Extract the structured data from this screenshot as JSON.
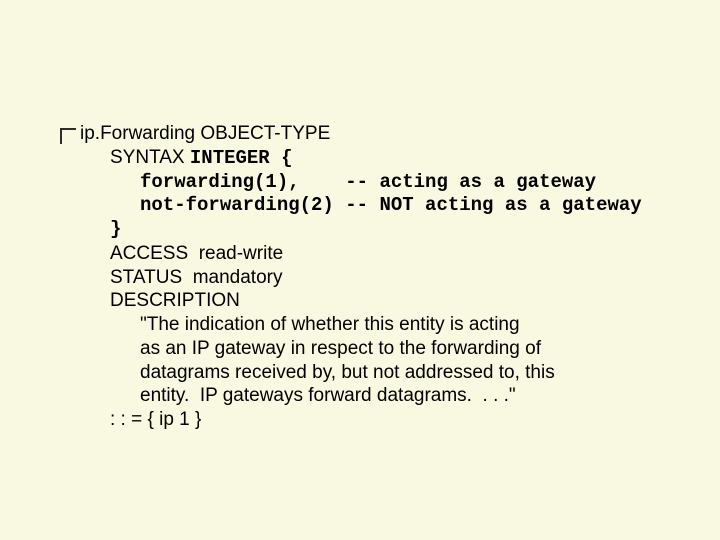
{
  "mib": {
    "objectName": "ip.Forwarding",
    "objectTypeKeyword": "OBJECT-TYPE",
    "syntaxKeyword": "SYNTAX",
    "syntaxType": "INTEGER {",
    "enum1": "forwarding(1),    -- acting as a gateway",
    "enum2": "not-forwarding(2) -- NOT acting as a gateway",
    "closeBrace": "}",
    "accessKeyword": "ACCESS",
    "accessValue": "read-write",
    "statusKeyword": "STATUS",
    "statusValue": "mandatory",
    "descKeyword": "DESCRIPTION",
    "desc1": "\"The indication of whether this entity is acting",
    "desc2": "as an IP gateway in respect to the forwarding of",
    "desc3": "datagrams received by, but not addressed to, this",
    "desc4": "entity.  IP gateways forward datagrams.  . . .\"",
    "assignment": ": : = { ip 1 }"
  }
}
